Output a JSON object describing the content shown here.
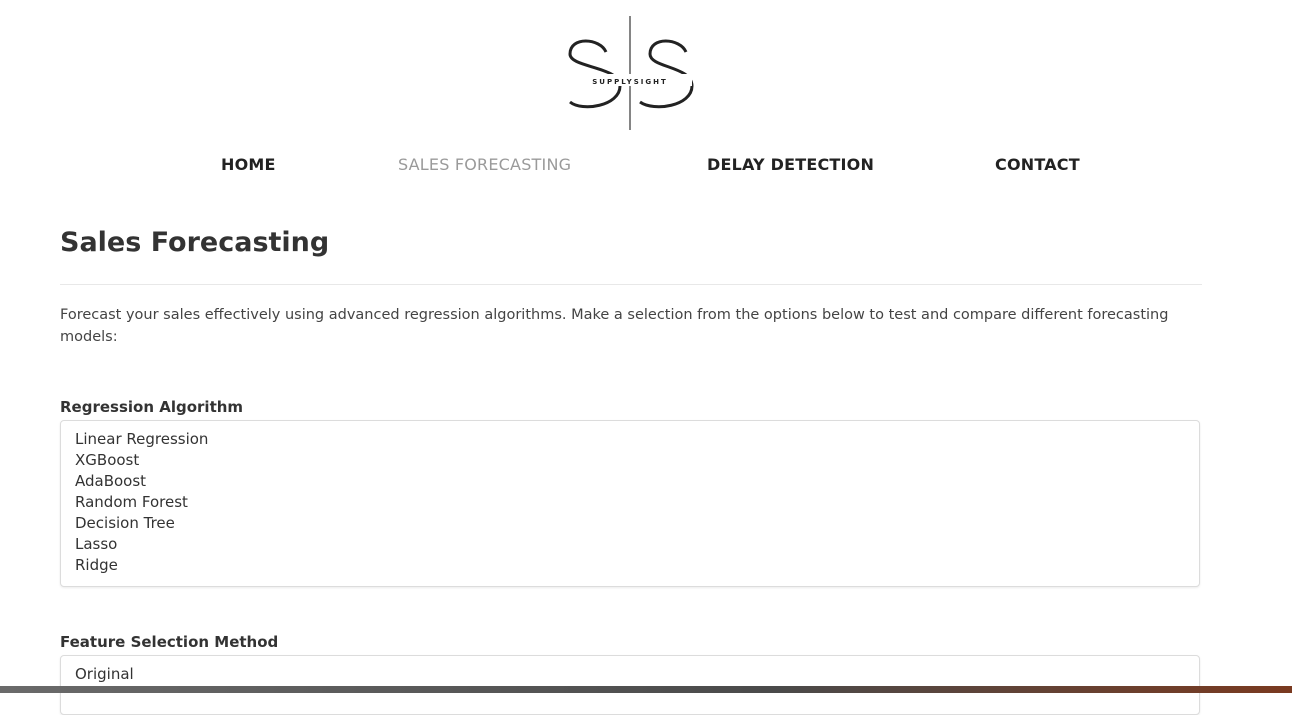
{
  "logo": {
    "brand_text": "SUPPLYSIGHT",
    "monogram": "SS"
  },
  "nav": {
    "items": [
      {
        "label": "HOME",
        "active": false
      },
      {
        "label": "SALES FORECASTING",
        "active": true
      },
      {
        "label": "DELAY DETECTION",
        "active": false
      },
      {
        "label": "CONTACT",
        "active": false
      }
    ]
  },
  "page": {
    "title": "Sales Forecasting",
    "intro": "Forecast your sales effectively using advanced regression algorithms. Make a selection from the options below to test and compare different forecasting models:"
  },
  "form": {
    "algorithm": {
      "label": "Regression Algorithm",
      "options": [
        "Linear Regression",
        "XGBoost",
        "AdaBoost",
        "Random Forest",
        "Decision Tree",
        "Lasso",
        "Ridge"
      ]
    },
    "feature_selection": {
      "label": "Feature Selection Method",
      "options": [
        "Original"
      ]
    }
  },
  "colors": {
    "nav_active": "#9a9a9a",
    "text": "#222222",
    "border": "#dcdcdc"
  }
}
